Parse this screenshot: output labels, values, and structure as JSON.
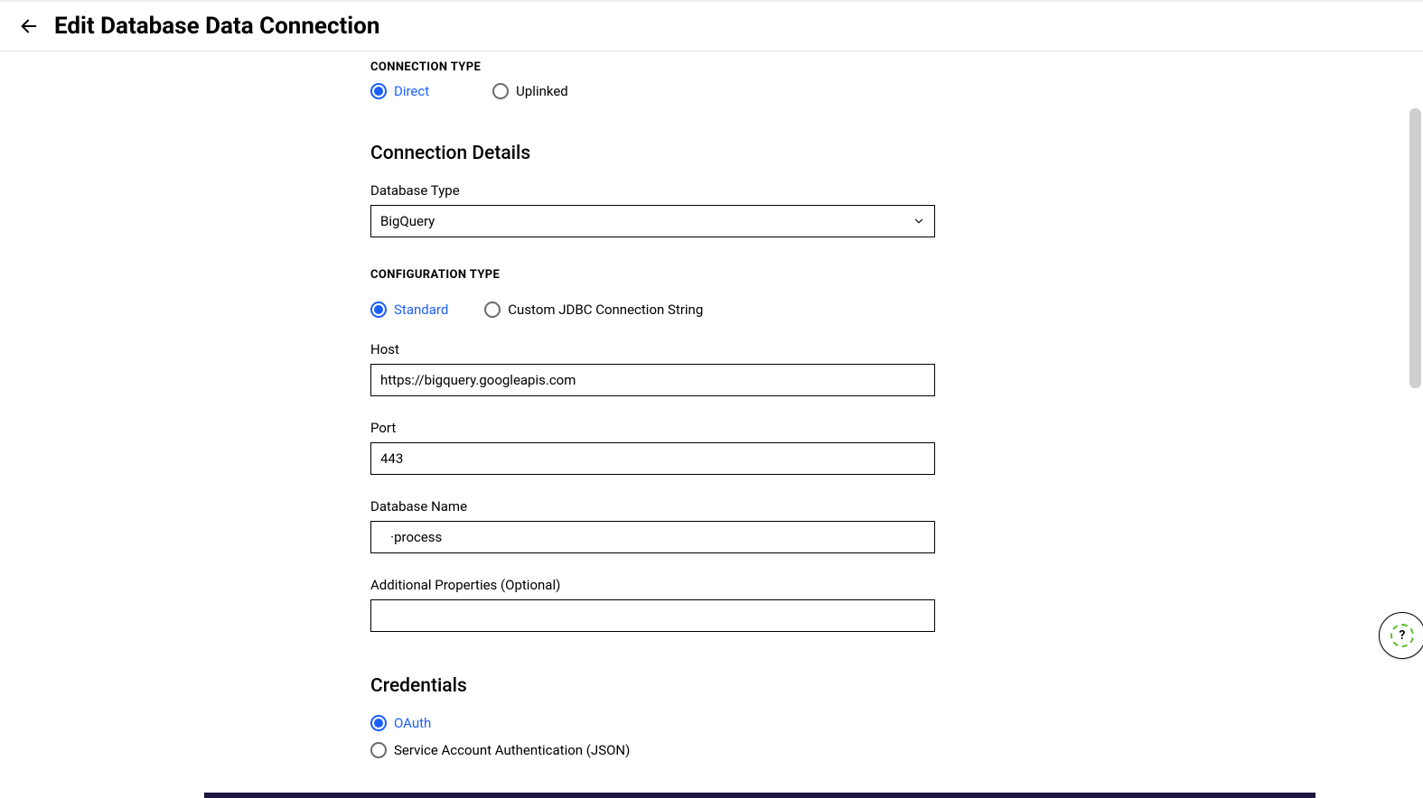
{
  "header": {
    "title": "Edit Database Data Connection"
  },
  "connectionType": {
    "heading": "CONNECTION TYPE",
    "direct": "Direct",
    "uplinked": "Uplinked"
  },
  "connectionDetails": {
    "heading": "Connection Details",
    "dbTypeLabel": "Database Type",
    "dbTypeValue": "BigQuery",
    "configHeading": "CONFIGURATION TYPE",
    "standard": "Standard",
    "custom": "Custom JDBC Connection String",
    "hostLabel": "Host",
    "hostValue": "https://bigquery.googleapis.com",
    "portLabel": "Port",
    "portValue": "443",
    "dbNameLabel": "Database Name",
    "dbNameValue": "   ·process",
    "addlPropsLabel": "Additional Properties (Optional)",
    "addlPropsValue": ""
  },
  "credentials": {
    "heading": "Credentials",
    "oauth": "OAuth",
    "svcAcct": "Service Account Authentication (JSON)"
  },
  "helpGlyph": "?"
}
